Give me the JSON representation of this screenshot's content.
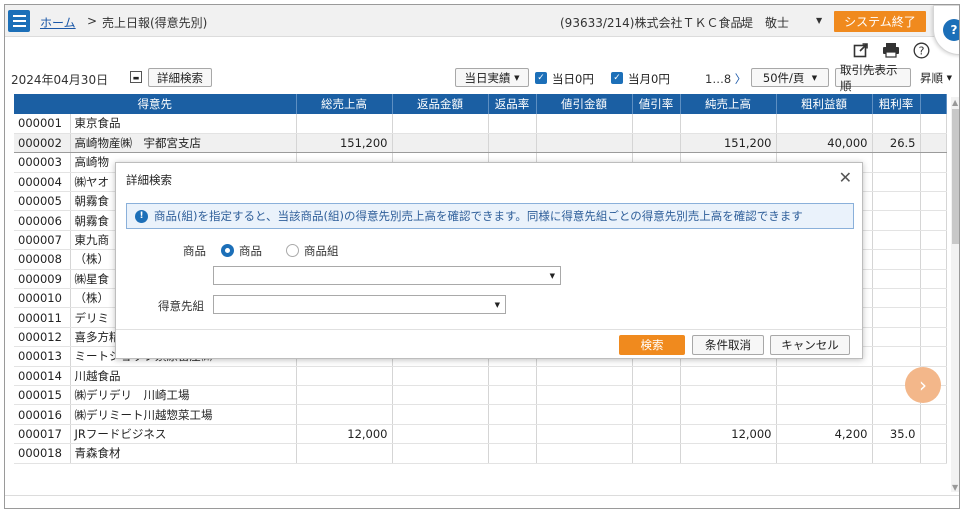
{
  "header": {
    "home": "ホーム",
    "sep": ">",
    "page_title": "売上日報(得意先別)",
    "company": "(93633/214)株式会社ＴＫＣ食品",
    "user": "堤　敬士",
    "exit_label": "システム終了"
  },
  "icons": {
    "menu": "hamburger-menu-icon",
    "export": "export-icon",
    "print": "print-icon",
    "help": "help-icon",
    "calendar": "calendar-icon"
  },
  "toolbar": {
    "date": "2024年04月30日",
    "detail_search": "詳細検索",
    "today_actual": "当日実績",
    "chk_today_zero": "当日0円",
    "chk_month_zero": "当月0円",
    "pager": "1…8",
    "per_page": "50件/頁",
    "sort_order": "取引先表示順",
    "asc": "昇順"
  },
  "table": {
    "columns": [
      "得意先",
      "総売上高",
      "返品金額",
      "返品率",
      "値引金額",
      "値引率",
      "純売上高",
      "粗利益額",
      "粗利率"
    ],
    "rows": [
      {
        "code": "000001",
        "name": "東京食品",
        "gross": "",
        "net": "",
        "profit": "",
        "rate": ""
      },
      {
        "code": "000002",
        "name": "高崎物産㈱　宇都宮支店",
        "gross": "151,200",
        "net": "151,200",
        "profit": "40,000",
        "rate": "26.5"
      },
      {
        "code": "000003",
        "name": "高崎物",
        "gross": "",
        "net": "",
        "profit": "",
        "rate": ""
      },
      {
        "code": "000004",
        "name": "㈱ヤオ",
        "gross": "",
        "net": "",
        "profit": "",
        "rate": ""
      },
      {
        "code": "000005",
        "name": "朝霧食",
        "gross": "",
        "net": "",
        "profit": "",
        "rate": ""
      },
      {
        "code": "000006",
        "name": "朝霧食",
        "gross": "",
        "net": "",
        "profit": "",
        "rate": ""
      },
      {
        "code": "000007",
        "name": "東九商",
        "gross": "",
        "net": "",
        "profit": "",
        "rate": ""
      },
      {
        "code": "000008",
        "name": "（株）",
        "gross": "",
        "net": "",
        "profit": "",
        "rate": ""
      },
      {
        "code": "000009",
        "name": "㈱星食",
        "gross": "",
        "net": "",
        "profit": "",
        "rate": ""
      },
      {
        "code": "000010",
        "name": "（株）",
        "gross": "",
        "net": "",
        "profit": "",
        "rate": ""
      },
      {
        "code": "000011",
        "name": "デリミ",
        "gross": "",
        "net": "",
        "profit": "",
        "rate": ""
      },
      {
        "code": "000012",
        "name": "喜多方精肉㈱",
        "gross": "",
        "net": "",
        "profit": "",
        "rate": ""
      },
      {
        "code": "000013",
        "name": "ミートショップ須原畜産㈱",
        "gross": "",
        "net": "",
        "profit": "",
        "rate": ""
      },
      {
        "code": "000014",
        "name": "川越食品",
        "gross": "",
        "net": "",
        "profit": "",
        "rate": ""
      },
      {
        "code": "000015",
        "name": "㈱デリデリ　川崎工場",
        "gross": "",
        "net": "",
        "profit": "",
        "rate": ""
      },
      {
        "code": "000016",
        "name": "㈱デリミート川越惣菜工場",
        "gross": "",
        "net": "",
        "profit": "",
        "rate": ""
      },
      {
        "code": "000017",
        "name": "JRフードビジネス",
        "gross": "12,000",
        "net": "12,000",
        "profit": "4,200",
        "rate": "35.0"
      },
      {
        "code": "000018",
        "name": "青森食材",
        "gross": "",
        "net": "",
        "profit": "",
        "rate": ""
      }
    ]
  },
  "dialog": {
    "title": "詳細検索",
    "info": "商品(組)を指定すると、当該商品(組)の得意先別売上高を確認できます。同様に得意先組ごとの得意先別売上高を確認できます",
    "product_label": "商品",
    "radio_product": "商品",
    "radio_group": "商品組",
    "customer_group_label": "得意先組",
    "search_btn": "検索",
    "clear_btn": "条件取消",
    "cancel_btn": "キャンセル"
  }
}
